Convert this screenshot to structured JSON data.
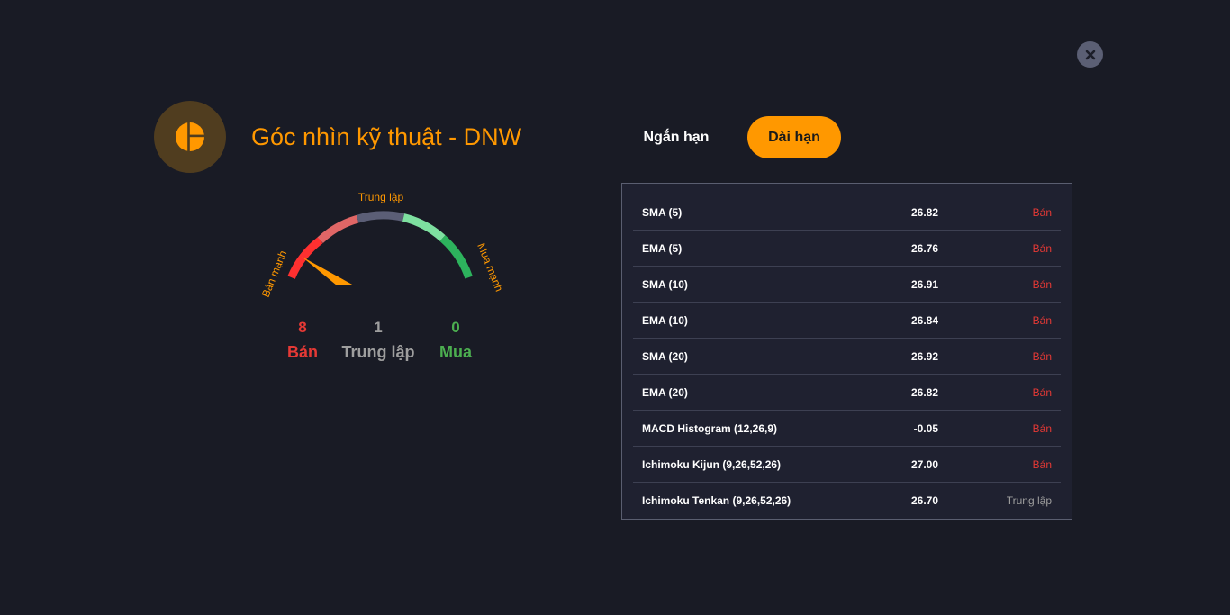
{
  "title": "Góc nhìn kỹ thuật - DNW",
  "tabs": [
    {
      "label": "Ngắn hạn",
      "active": false
    },
    {
      "label": "Dài hạn",
      "active": true
    }
  ],
  "gauge": {
    "labels": {
      "strong_sell": "Bán mạnh",
      "neutral": "Trung lập",
      "strong_buy": "Mua mạnh"
    }
  },
  "summary": {
    "sell": {
      "count": "8",
      "label": "Bán"
    },
    "neutral": {
      "count": "1",
      "label": "Trung lập"
    },
    "buy": {
      "count": "0",
      "label": "Mua"
    }
  },
  "indicators": [
    {
      "name": "SMA (5)",
      "value": "26.82",
      "signal": "Bán"
    },
    {
      "name": "EMA (5)",
      "value": "26.76",
      "signal": "Bán"
    },
    {
      "name": "SMA (10)",
      "value": "26.91",
      "signal": "Bán"
    },
    {
      "name": "EMA (10)",
      "value": "26.84",
      "signal": "Bán"
    },
    {
      "name": "SMA (20)",
      "value": "26.92",
      "signal": "Bán"
    },
    {
      "name": "EMA (20)",
      "value": "26.82",
      "signal": "Bán"
    },
    {
      "name": "MACD Histogram (12,26,9)",
      "value": "-0.05",
      "signal": "Bán"
    },
    {
      "name": "Ichimoku Kijun (9,26,52,26)",
      "value": "27.00",
      "signal": "Bán"
    },
    {
      "name": "Ichimoku Tenkan (9,26,52,26)",
      "value": "26.70",
      "signal": "Trung lập"
    }
  ],
  "colors": {
    "accent": "#ff9800",
    "sell": "#e53935",
    "neutral": "#9e9e9e",
    "buy": "#4caf50"
  },
  "icons": {
    "close": "close-icon",
    "logo": "gauge-logo-icon"
  }
}
